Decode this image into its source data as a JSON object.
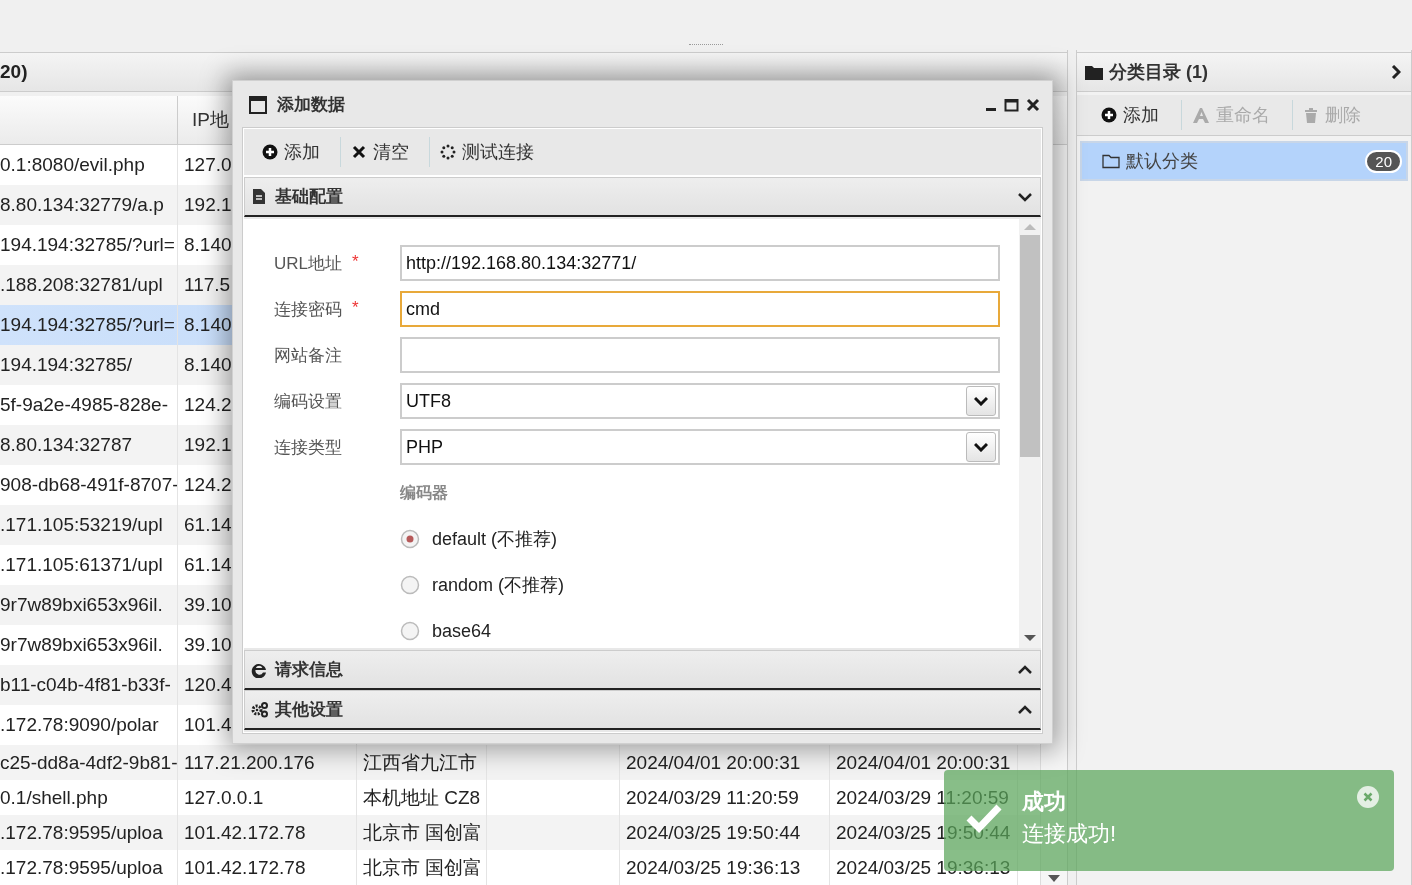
{
  "list_panel": {
    "title": "20)",
    "columns": [
      {},
      {
        "label": "IP地"
      }
    ],
    "rows": [
      {
        "cells": [
          "0.1:8080/evil.php",
          "127.0"
        ],
        "selected": false
      },
      {
        "cells": [
          "8.80.134:32779/a.p",
          "192.1"
        ],
        "selected": false
      },
      {
        "cells": [
          "194.194:32785/?url=",
          "8.140"
        ],
        "selected": false
      },
      {
        "cells": [
          ".188.208:32781/upl",
          "117.5"
        ],
        "selected": false
      },
      {
        "cells": [
          "194.194:32785/?url=",
          "8.140"
        ],
        "selected": true
      },
      {
        "cells": [
          "194.194:32785/",
          "8.140"
        ],
        "selected": false
      },
      {
        "cells": [
          "5f-9a2e-4985-828e-",
          "124.2"
        ],
        "selected": false
      },
      {
        "cells": [
          "8.80.134:32787",
          "192.1"
        ],
        "selected": false
      },
      {
        "cells": [
          "908-db68-491f-8707-",
          "124.2"
        ],
        "selected": false
      },
      {
        "cells": [
          ".171.105:53219/upl",
          "61.14"
        ],
        "selected": false
      },
      {
        "cells": [
          ".171.105:61371/upl",
          "61.14"
        ],
        "selected": false
      },
      {
        "cells": [
          "9r7w89bxi653x96il.",
          "39.10"
        ],
        "selected": false
      },
      {
        "cells": [
          "9r7w89bxi653x96il.",
          "39.10"
        ],
        "selected": false
      },
      {
        "cells": [
          "b11-c04b-4f81-b33f-",
          "120.4"
        ],
        "selected": false
      },
      {
        "cells": [
          ".172.78:9090/polar",
          "101.4"
        ],
        "selected": false
      },
      {
        "cells": [
          "c25-dd8a-4df2-9b81-",
          "117.21.200.176",
          "江西省九江市",
          "2024/04/01 20:00:31",
          "2024/04/01 20:00:31"
        ],
        "selected": false
      },
      {
        "cells": [
          "0.1/shell.php",
          "127.0.0.1",
          "本机地址 CZ8",
          "2024/03/29 11:20:59",
          "2024/03/29 11:20:59"
        ],
        "selected": false
      },
      {
        "cells": [
          ".172.78:9595/uploa",
          "101.42.172.78",
          "北京市 国创富",
          "2024/03/25 19:50:44",
          "2024/03/25 19:50:44"
        ],
        "selected": false
      },
      {
        "cells": [
          ".172.78:9595/uploa",
          "101.42.172.78",
          "北京市 国创富",
          "2024/03/25 19:36:13",
          "2024/03/25 19:36:13"
        ],
        "selected": false
      }
    ]
  },
  "dialog": {
    "title": "添加数据",
    "toolbar": [
      "添加",
      "清空",
      "测试连接"
    ],
    "sections": [
      {
        "title": "基础配置",
        "expanded": true
      },
      {
        "title": "请求信息",
        "expanded": false
      },
      {
        "title": "其他设置",
        "expanded": false
      }
    ],
    "fields": [
      {
        "kind": "text",
        "label": "URL地址",
        "marker": "*",
        "value": "http://192.168.80.134:32771/",
        "focused": false
      },
      {
        "kind": "text",
        "label": "连接密码",
        "marker": "*",
        "value": "cmd",
        "focused": true
      },
      {
        "kind": "text",
        "label": "网站备注",
        "focused": false
      },
      {
        "kind": "select",
        "label": "编码设置",
        "value": "UTF8",
        "focused": false
      },
      {
        "kind": "select",
        "label": "连接类型",
        "value": "PHP",
        "focused": false
      }
    ],
    "encoder": {
      "label": "编码器",
      "options": [
        {
          "label": "default (不推荐)",
          "selected": true
        },
        {
          "label": "random (不推荐)",
          "selected": false
        },
        {
          "label": "base64",
          "selected": false
        }
      ]
    }
  },
  "category_panel": {
    "title": "分类目录 (1)",
    "toolbar": [
      {
        "label": "添加",
        "disabled": false
      },
      {
        "label": "重命名",
        "disabled": true
      },
      {
        "label": "删除",
        "disabled": true
      }
    ],
    "items": [
      {
        "label": "默认分类",
        "count": "20",
        "selected": true
      }
    ]
  },
  "toast": {
    "title": "成功",
    "message": "连接成功!"
  }
}
